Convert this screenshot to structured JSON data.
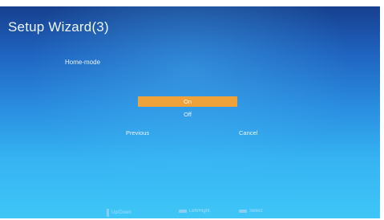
{
  "window": {
    "title": "Setup Wizard(3)"
  },
  "setting": {
    "label": "Home-mode"
  },
  "options": [
    {
      "label": "On",
      "selected": true
    },
    {
      "label": "Off",
      "selected": false
    }
  ],
  "nav": {
    "previous": "Previous",
    "cancel": "Cancel"
  },
  "footer": {
    "hints": [
      {
        "label": "Up/Down",
        "icon": "up-down-arrow-icon"
      },
      {
        "label": "Left/Right",
        "icon": "left-right-arrow-icon"
      },
      {
        "label": "Select",
        "icon": "select-icon"
      }
    ]
  },
  "colors": {
    "accent": "#f0a23a",
    "background_top": "#173f8e",
    "background_bottom": "#3fc6f7"
  }
}
